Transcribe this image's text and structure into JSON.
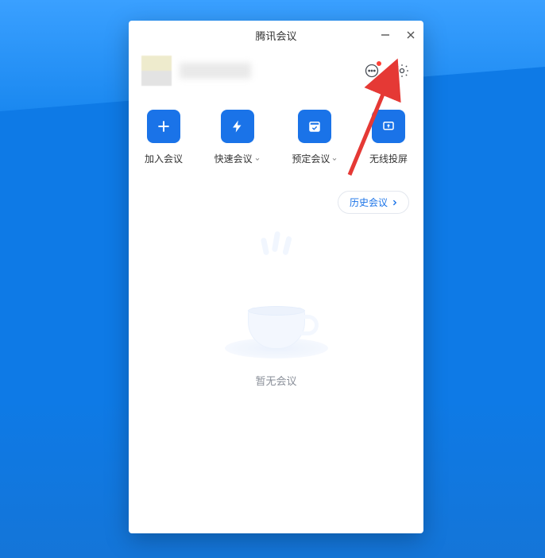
{
  "window": {
    "title": "腾讯会议"
  },
  "actions": {
    "join": "加入会议",
    "quick": "快速会议",
    "schedule": "预定会议",
    "cast": "无线投屏"
  },
  "history": {
    "label": "历史会议"
  },
  "empty": {
    "label": "暂无会议"
  }
}
